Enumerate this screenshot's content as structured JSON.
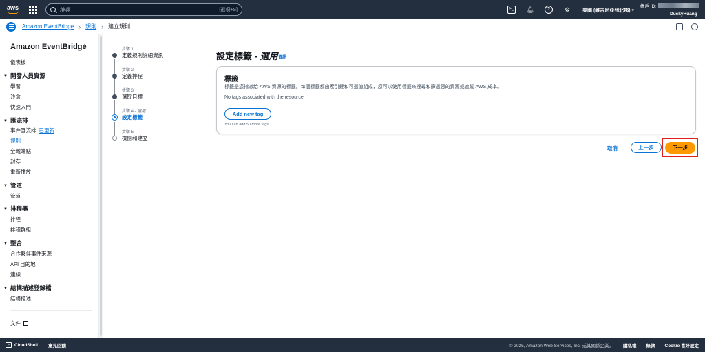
{
  "topnav": {
    "logo": "aws",
    "search_placeholder": "搜尋",
    "search_shortcut": "[選項+S]",
    "icons": [
      "cloudshell-icon",
      "bell-icon",
      "help-icon",
      "gear-icon"
    ],
    "region": "美國 (維吉尼亞州北部)",
    "account_label": "帳戶 ID:",
    "username": "DuckyHuang"
  },
  "breadcrumb": {
    "items": [
      "Amazon EventBridge",
      "規則",
      "建立規則"
    ]
  },
  "sidebar": {
    "title": "Amazon EventBridge",
    "dashboard": "儀表板",
    "sections": [
      {
        "title": "開發人員資源",
        "items": [
          "學習",
          "沙盒",
          "快速入門"
        ]
      },
      {
        "title": "匯流排",
        "items": [
          "事件匯流排",
          "規則",
          "全域端點",
          "封存",
          "重新播放"
        ],
        "badge": "已更新",
        "active": "規則"
      },
      {
        "title": "管道",
        "items": [
          "管道"
        ]
      },
      {
        "title": "排程器",
        "items": [
          "排程",
          "排程群組"
        ]
      },
      {
        "title": "整合",
        "items": [
          "合作夥伴事件來源",
          "API 目的地",
          "連線"
        ]
      },
      {
        "title": "結構描述登錄檔",
        "items": [
          "結構描述"
        ]
      }
    ],
    "docs": "文件"
  },
  "steps": [
    {
      "num": "步驟 1",
      "label": "定義規則詳細資訊",
      "state": "done"
    },
    {
      "num": "步驟 2",
      "label": "定義排程",
      "state": "done"
    },
    {
      "num": "步驟 3",
      "label": "選取目標",
      "state": "done"
    },
    {
      "num": "步驟 4 - ",
      "optional": "選用",
      "label": "設定標籤",
      "state": "current"
    },
    {
      "num": "步驟 5",
      "label": "檢閱和建立",
      "state": "todo"
    }
  ],
  "main": {
    "title": "設定標籤 - ",
    "title_optional": "選用",
    "info": "資訊",
    "panel": {
      "title": "標籤",
      "description": "標籤是您指派給 AWS 資源的標籤。每個標籤都由索引鍵和可選值組成，您可以使用標籤來搜尋和篩選您的資源或追蹤 AWS 成本。",
      "empty": "No tags associated with the resource.",
      "add_button": "Add new tag",
      "hint": "You can add 50 more tags"
    },
    "cancel": "取消",
    "previous": "上一步",
    "next": "下一步"
  },
  "footer": {
    "cloudshell": "CloudShell",
    "feedback": "意見回饋",
    "copyright": "© 2025, Amazon Web Services, Inc. 或其關係企業。",
    "privacy": "隱私權",
    "terms": "條款",
    "cookies": "Cookie 喜好設定"
  },
  "colors": {
    "nav_bg": "#232f3e",
    "link": "#0972d3",
    "primary_button": "#ff9900",
    "highlight": "#e02020"
  }
}
